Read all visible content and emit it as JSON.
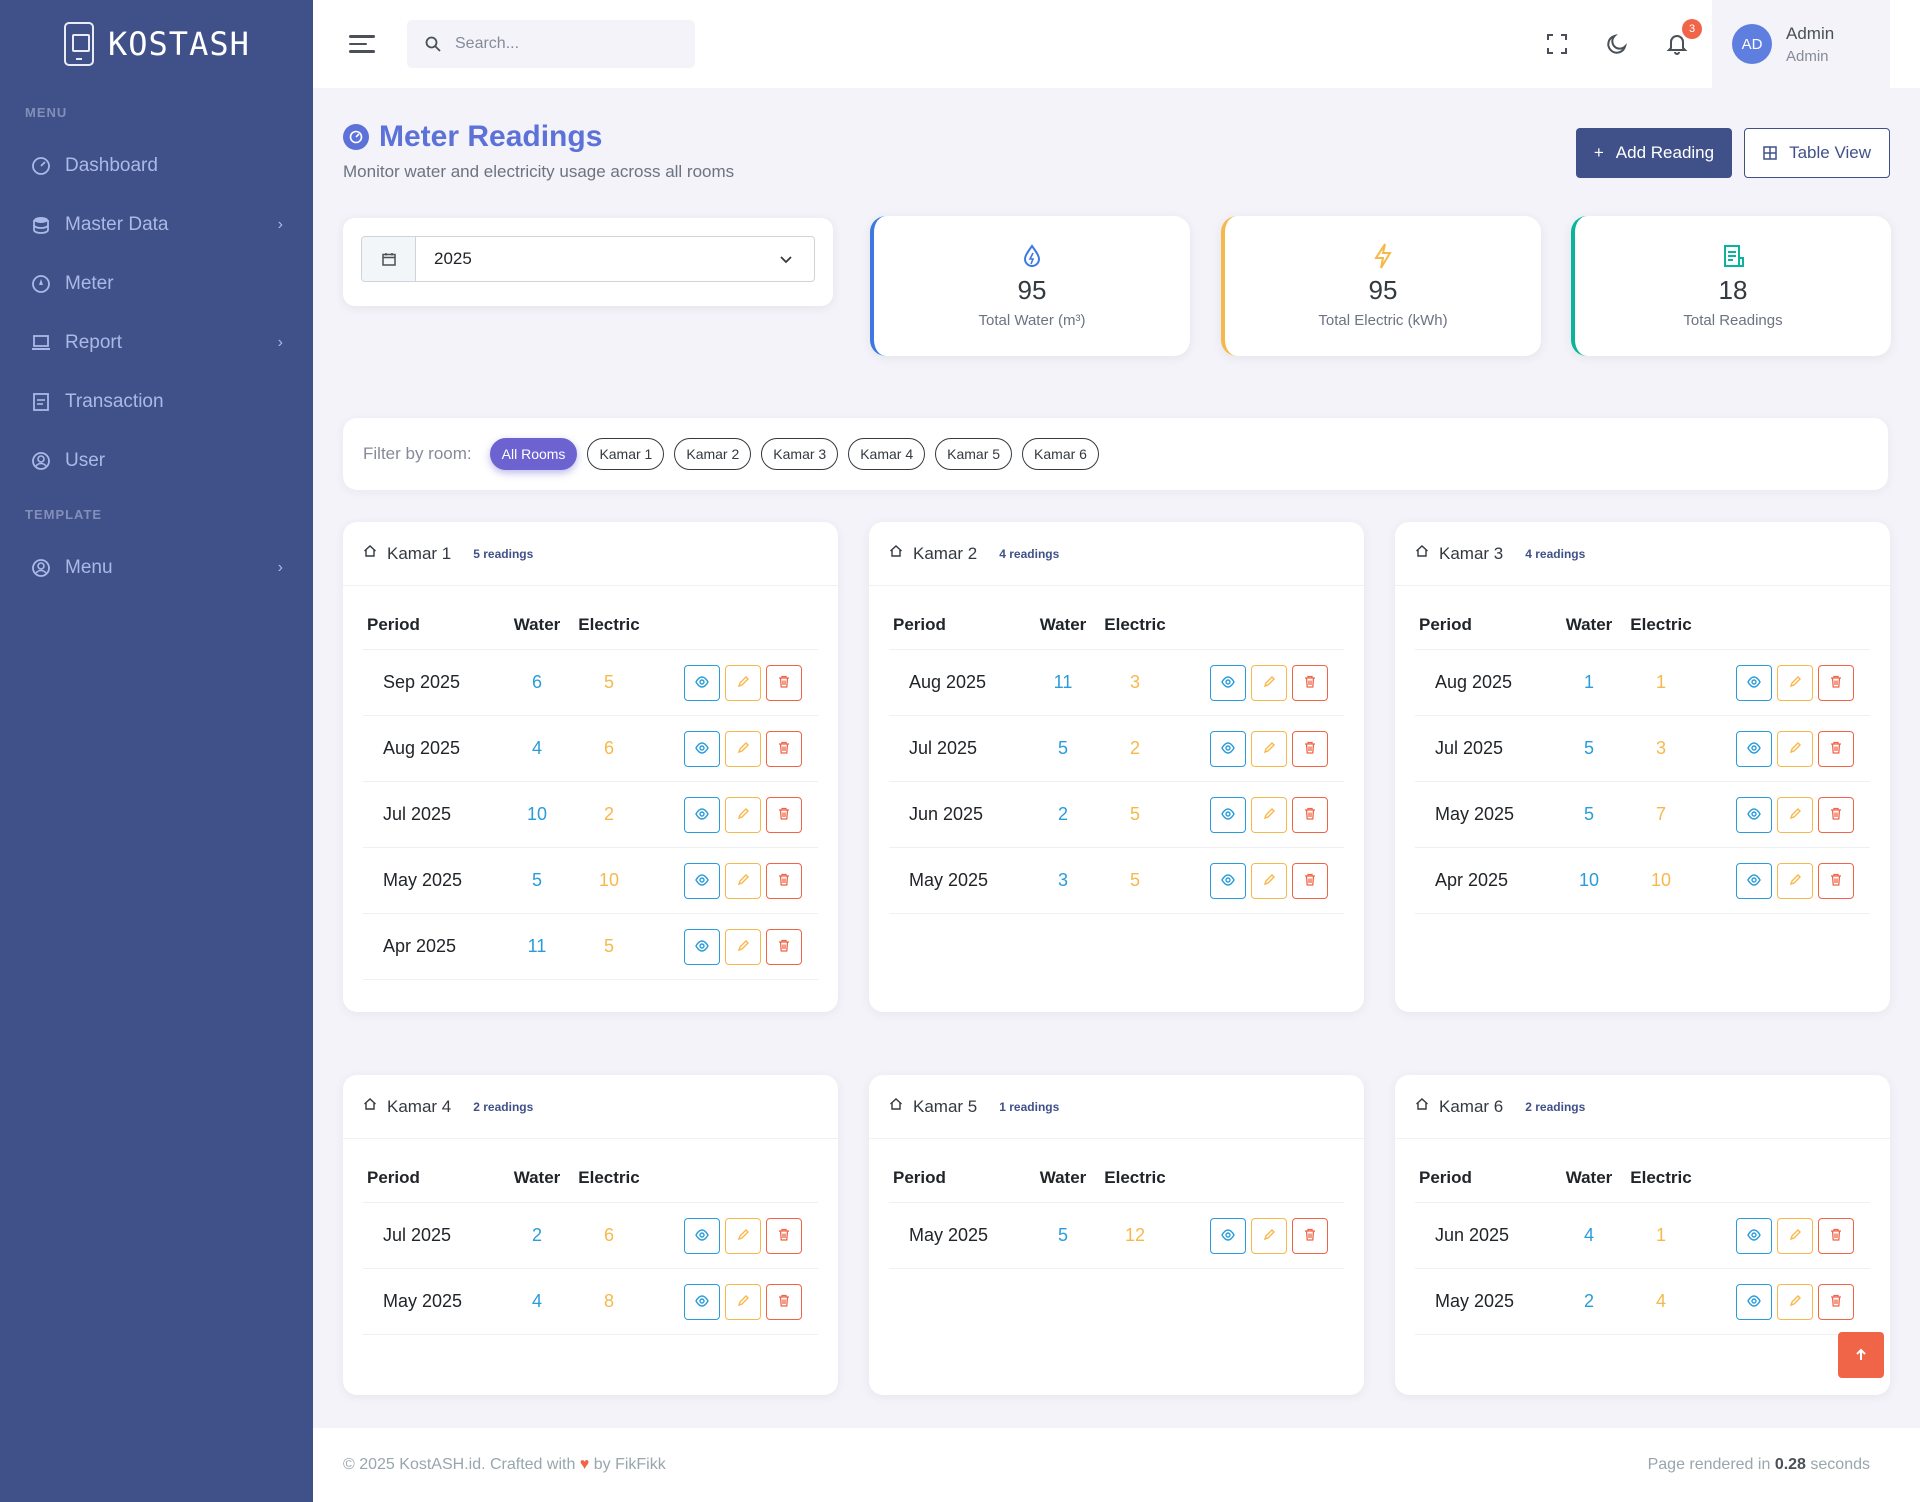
{
  "brand": {
    "name": "KOSTASH"
  },
  "sidebar": {
    "menu_title": "MENU",
    "items": [
      {
        "label": "Dashboard",
        "icon": "dashboard-icon"
      },
      {
        "label": "Master Data",
        "icon": "database-icon",
        "has_sub": true
      },
      {
        "label": "Meter",
        "icon": "meter-icon"
      },
      {
        "label": "Report",
        "icon": "laptop-icon",
        "has_sub": true
      },
      {
        "label": "Transaction",
        "icon": "receipt-icon"
      },
      {
        "label": "User",
        "icon": "user-circle-icon"
      }
    ],
    "template_title": "TEMPLATE",
    "template_items": [
      {
        "label": "Menu",
        "icon": "user-circle-icon",
        "has_sub": true
      }
    ]
  },
  "topbar": {
    "search_placeholder": "Search...",
    "notification_count": "3",
    "user": {
      "initials": "AD",
      "name": "Admin",
      "role": "Admin"
    }
  },
  "page": {
    "title": "Meter Readings",
    "subtitle": "Monitor water and electricity usage across all rooms",
    "add_button": "Add Reading",
    "table_view_button": "Table View",
    "year": "2025"
  },
  "stats": [
    {
      "value": "95",
      "label": "Total Water (m³)",
      "color": "#3d78e3",
      "icon": "water-drop-icon"
    },
    {
      "value": "95",
      "label": "Total Electric (kWh)",
      "color": "#f7b84b",
      "icon": "lightning-icon"
    },
    {
      "value": "18",
      "label": "Total Readings",
      "color": "#0ab39c",
      "icon": "document-icon"
    }
  ],
  "filter": {
    "label": "Filter by room:",
    "options": [
      "All Rooms",
      "Kamar 1",
      "Kamar 2",
      "Kamar 3",
      "Kamar 4",
      "Kamar 5",
      "Kamar 6"
    ],
    "active": "All Rooms"
  },
  "table_headers": {
    "period": "Period",
    "water": "Water",
    "electric": "Electric"
  },
  "rooms": [
    {
      "name": "Kamar 1",
      "count": "5 readings",
      "rows": [
        {
          "period": "Sep 2025",
          "water": "6",
          "electric": "5"
        },
        {
          "period": "Aug 2025",
          "water": "4",
          "electric": "6"
        },
        {
          "period": "Jul 2025",
          "water": "10",
          "electric": "2"
        },
        {
          "period": "May 2025",
          "water": "5",
          "electric": "10"
        },
        {
          "period": "Apr 2025",
          "water": "11",
          "electric": "5"
        }
      ]
    },
    {
      "name": "Kamar 2",
      "count": "4 readings",
      "rows": [
        {
          "period": "Aug 2025",
          "water": "11",
          "electric": "3"
        },
        {
          "period": "Jul 2025",
          "water": "5",
          "electric": "2"
        },
        {
          "period": "Jun 2025",
          "water": "2",
          "electric": "5"
        },
        {
          "period": "May 2025",
          "water": "3",
          "electric": "5"
        }
      ]
    },
    {
      "name": "Kamar 3",
      "count": "4 readings",
      "rows": [
        {
          "period": "Aug 2025",
          "water": "1",
          "electric": "1"
        },
        {
          "period": "Jul 2025",
          "water": "5",
          "electric": "3"
        },
        {
          "period": "May 2025",
          "water": "5",
          "electric": "7"
        },
        {
          "period": "Apr 2025",
          "water": "10",
          "electric": "10"
        }
      ]
    },
    {
      "name": "Kamar 4",
      "count": "2 readings",
      "rows": [
        {
          "period": "Jul 2025",
          "water": "2",
          "electric": "6"
        },
        {
          "period": "May 2025",
          "water": "4",
          "electric": "8"
        }
      ]
    },
    {
      "name": "Kamar 5",
      "count": "1 readings",
      "rows": [
        {
          "period": "May 2025",
          "water": "5",
          "electric": "12"
        }
      ]
    },
    {
      "name": "Kamar 6",
      "count": "2 readings",
      "rows": [
        {
          "period": "Jun 2025",
          "water": "4",
          "electric": "1"
        },
        {
          "period": "May 2025",
          "water": "2",
          "electric": "4"
        }
      ]
    }
  ],
  "footer": {
    "left_prefix": "© 2025 KostASH.id. Crafted with",
    "left_suffix": "by FikFikk",
    "right_prefix": "Page rendered in",
    "right_time": "0.28",
    "right_suffix": "seconds"
  }
}
